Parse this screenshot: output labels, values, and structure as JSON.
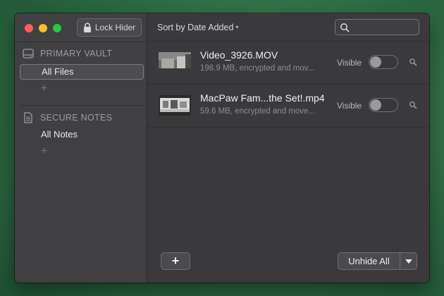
{
  "window": {
    "lock_button_label": "Lock Hider"
  },
  "sidebar": {
    "sections": [
      {
        "title": "PRIMARY VAULT",
        "icon": "drive-icon",
        "items": [
          {
            "label": "All Files",
            "selected": true
          }
        ],
        "add_label": "+"
      },
      {
        "title": "SECURE NOTES",
        "icon": "note-icon",
        "items": [
          {
            "label": "All Notes",
            "selected": false
          }
        ],
        "add_label": "+"
      }
    ]
  },
  "toolbar": {
    "sort_label": "Sort by Date Added",
    "sort_caret": "▾",
    "search_placeholder": ""
  },
  "files": [
    {
      "name": "Video_3926.MOV",
      "meta": "198.9 MB, encrypted and mov...",
      "visibility_label": "Visible",
      "visible": false
    },
    {
      "name": "MacPaw Fam...the Set!.mp4",
      "meta": "59.6 MB, encrypted and move...",
      "visibility_label": "Visible",
      "visible": false
    }
  ],
  "footer": {
    "add_label": "+",
    "unhide_label": "Unhide All"
  },
  "colors": {
    "close": "#fe5f57",
    "minimize": "#febc2e",
    "zoom": "#28c840"
  }
}
